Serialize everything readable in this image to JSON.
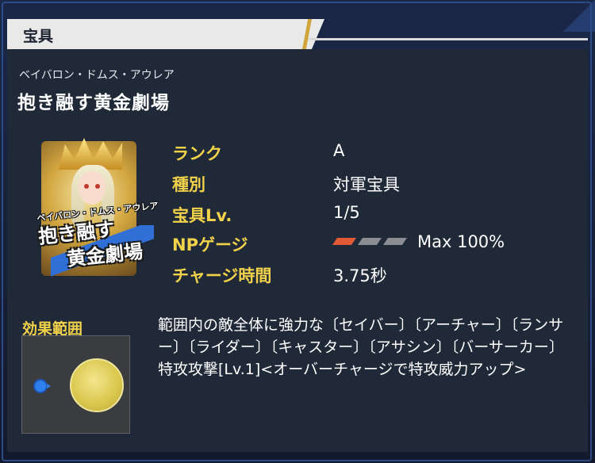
{
  "header": {
    "title": "宝具"
  },
  "noble_phantasm": {
    "ruby": "ベイバロン・ドムス・アウレア",
    "name": "抱き融す黄金劇場",
    "card": {
      "ruby": "ベイバロン・ドムス・アウレア",
      "title_line1": "抱き融す",
      "title_line2": "黄金劇場"
    }
  },
  "stats": {
    "rank_label": "ランク",
    "rank_value": "A",
    "type_label": "種別",
    "type_value": "対軍宝具",
    "level_label": "宝具Lv.",
    "level_value": "1/5",
    "np_label": "NPゲージ",
    "np_max": "Max 100%",
    "charge_label": "チャージ時間",
    "charge_value": "3.75秒"
  },
  "np_gauge": {
    "filled_segments": 1,
    "total_segments": 3,
    "filled_color": "#e05a36",
    "empty_color": "#8a8d92"
  },
  "effect": {
    "range_label": "効果範囲",
    "description": "範囲内の敵全体に強力な〔セイバー〕〔アーチャー〕〔ランサー〕〔ライダー〕〔キャスター〕〔アサシン〕〔バーサーカー〕特攻攻撃[Lv.1]<オーバーチャージで特攻威力アップ>"
  }
}
